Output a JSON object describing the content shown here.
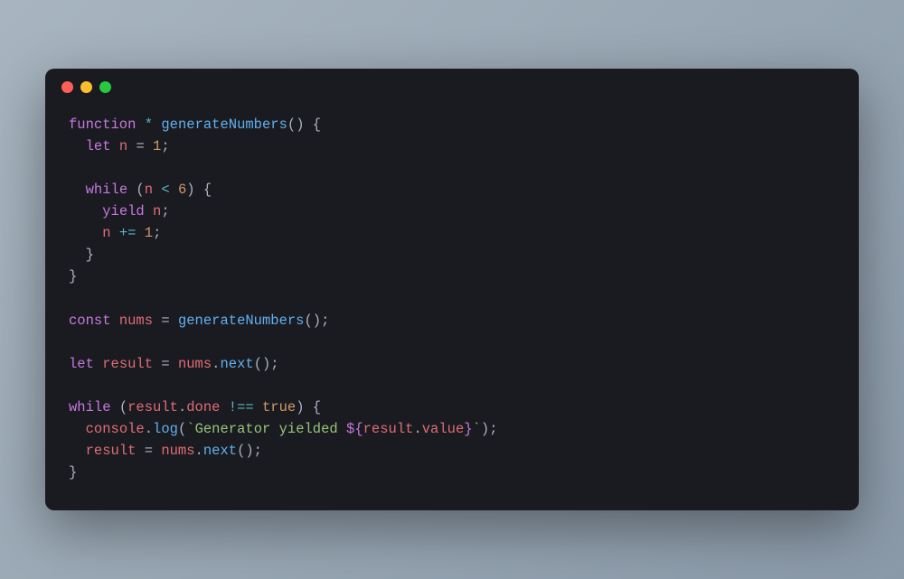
{
  "window": {
    "traffic_lights": [
      "close",
      "minimize",
      "zoom"
    ]
  },
  "code": {
    "line1": {
      "kw": "function",
      "star": "*",
      "fn": "generateNumbers",
      "open": "() {"
    },
    "line2": {
      "indent": "  ",
      "kw": "let",
      "var": "n",
      "eq": " = ",
      "num": "1",
      "semi": ";"
    },
    "line3": "",
    "line4": {
      "indent": "  ",
      "kw": "while",
      "open": " (",
      "var": "n",
      "op": " < ",
      "num": "6",
      "close": ") {"
    },
    "line5": {
      "indent": "    ",
      "kw": "yield",
      "sp": " ",
      "var": "n",
      "semi": ";"
    },
    "line6": {
      "indent": "    ",
      "var": "n",
      "op": " += ",
      "num": "1",
      "semi": ";"
    },
    "line7": {
      "indent": "  ",
      "brace": "}"
    },
    "line8": {
      "brace": "}"
    },
    "line9": "",
    "line10": {
      "kw": "const",
      "var": "nums",
      "eq": " = ",
      "fn": "generateNumbers",
      "call": "();"
    },
    "line11": "",
    "line12": {
      "kw": "let",
      "var": "result",
      "eq": " = ",
      "obj": "nums",
      "dot": ".",
      "fn": "next",
      "call": "();"
    },
    "line13": "",
    "line14": {
      "kw": "while",
      "open": " (",
      "obj": "result",
      "dot": ".",
      "prop": "done",
      "op": " !== ",
      "bool": "true",
      "close": ") {"
    },
    "line15": {
      "indent": "  ",
      "obj": "console",
      "dot": ".",
      "fn": "log",
      "open": "(",
      "tick1": "`",
      "str1": "Generator yielded ",
      "int_open": "${",
      "int_obj": "result",
      "int_dot": ".",
      "int_prop": "value",
      "int_close": "}",
      "tick2": "`",
      "close": ");"
    },
    "line16": {
      "indent": "  ",
      "var": "result",
      "eq": " = ",
      "obj": "nums",
      "dot": ".",
      "fn": "next",
      "call": "();"
    },
    "line17": {
      "brace": "}"
    }
  }
}
